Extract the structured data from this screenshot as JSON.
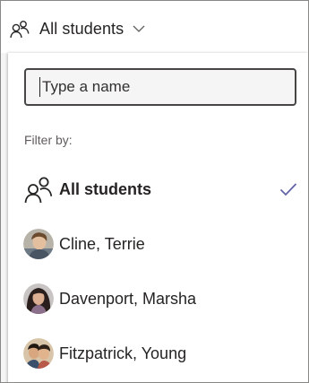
{
  "trigger": {
    "label": "All students",
    "icon": "people-icon",
    "chevron": "chevron-down-icon"
  },
  "search": {
    "placeholder": "Type a name",
    "value": ""
  },
  "filter": {
    "label": "Filter by:"
  },
  "options": [
    {
      "label": "All students",
      "icon": "people-icon",
      "selected": true
    },
    {
      "label": "Cline, Terrie",
      "icon": "avatar",
      "selected": false
    },
    {
      "label": "Davenport, Marsha",
      "icon": "avatar",
      "selected": false
    },
    {
      "label": "Fitzpatrick, Young",
      "icon": "avatar",
      "selected": false
    }
  ],
  "colors": {
    "accent": "#6264a7",
    "text": "#252423",
    "muted": "#605e5c"
  }
}
